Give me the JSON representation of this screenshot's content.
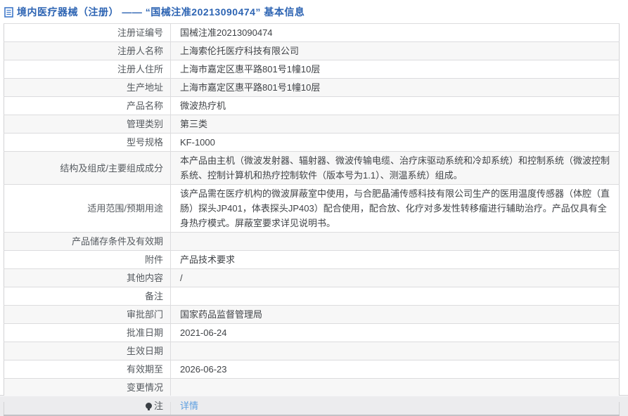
{
  "colors": {
    "header_text": "#2d64b3",
    "link": "#5e9fe0",
    "alt_row_bg": "#f7f7f7",
    "border": "#dcdcde"
  },
  "header": {
    "icon": "document-icon",
    "title": "境内医疗器械（注册） —— “国械注准20213090474” 基本信息"
  },
  "table": {
    "rows": [
      {
        "label": "注册证编号",
        "value": "国械注准20213090474"
      },
      {
        "label": "注册人名称",
        "value": "上海索伦托医疗科技有限公司"
      },
      {
        "label": "注册人住所",
        "value": "上海市嘉定区惠平路801号1幢10层"
      },
      {
        "label": "生产地址",
        "value": "上海市嘉定区惠平路801号1幢10层"
      },
      {
        "label": "产品名称",
        "value": "微波热疗机"
      },
      {
        "label": "管理类别",
        "value": "第三类"
      },
      {
        "label": "型号规格",
        "value": "KF-1000"
      },
      {
        "label": "结构及组成/主要组成成分",
        "value": "本产品由主机（微波发射器、辐射器、微波传输电缆、治疗床驱动系统和冷却系统）和控制系统（微波控制系统、控制计算机和热疗控制软件（版本号为1.1）、测温系统）组成。"
      },
      {
        "label": "适用范围/预期用途",
        "value": "该产品需在医疗机构的微波屏蔽室中使用，与合肥晶浦传感科技有限公司生产的医用温度传感器（体腔（直肠）探头JP401，体表探头JP403）配合使用，配合放、化疗对多发性转移瘤进行辅助治疗。产品仅具有全身热疗模式。屏蔽室要求详见说明书。"
      },
      {
        "label": "产品储存条件及有效期",
        "value": ""
      },
      {
        "label": "附件",
        "value": "产品技术要求"
      },
      {
        "label": "其他内容",
        "value": "/"
      },
      {
        "label": "备注",
        "value": ""
      },
      {
        "label": "审批部门",
        "value": "国家药品监督管理局"
      },
      {
        "label": "批准日期",
        "value": "2021-06-24"
      },
      {
        "label": "生效日期",
        "value": ""
      },
      {
        "label": "有效期至",
        "value": "2026-06-23"
      },
      {
        "label": "变更情况",
        "value": ""
      },
      {
        "label": "注",
        "value": "详情",
        "icon": "bulb-icon",
        "link": true
      }
    ]
  }
}
